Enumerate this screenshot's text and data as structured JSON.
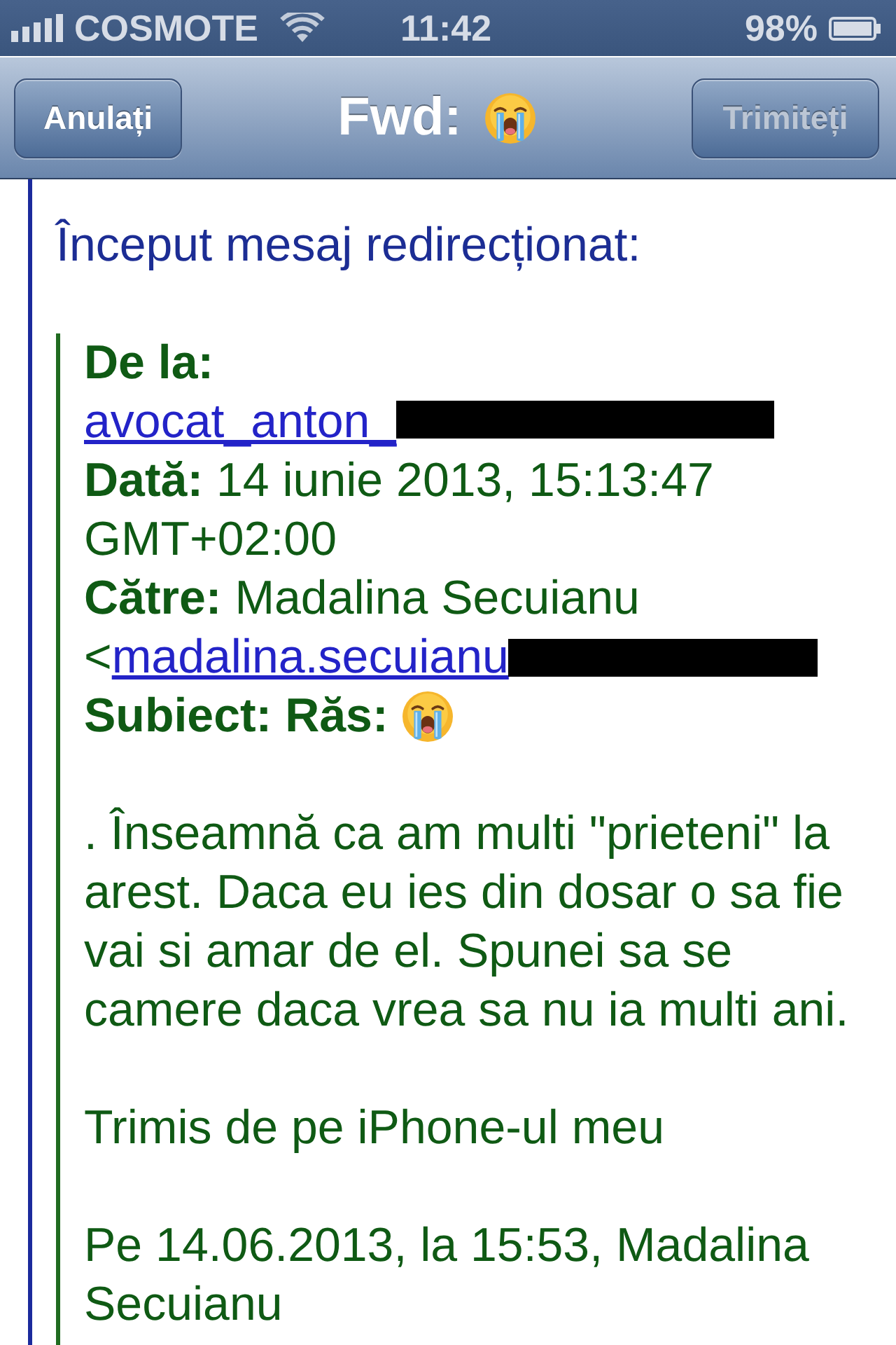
{
  "status_bar": {
    "carrier": "COSMOTE",
    "time": "11:42",
    "battery": "98%"
  },
  "nav_bar": {
    "cancel_button": {
      "label": "Anulați"
    },
    "title": "Fwd:",
    "send_button": {
      "label": "Trimiteți",
      "disabled": true
    }
  },
  "message": {
    "intro": "Început mesaj redirecționat:",
    "headers": [
      {
        "kind": "link",
        "label": "De la:",
        "link": "avocat_anton_",
        "redacted": true
      },
      {
        "kind": "text",
        "label": "Dată:",
        "value": "14 iunie 2013, 15:13:47 GMT+02:00"
      },
      {
        "kind": "text_link",
        "label": "Către:",
        "value": "Madalina Secuianu",
        "prefix": "<",
        "link": "madalina.secuianu",
        "redacted": true
      },
      {
        "kind": "subject",
        "label": "Subiect:",
        "value": "Răs:"
      }
    ],
    "body": [
      ". Înseamnă ca am multi \"prieteni\" la arest. Daca eu ies din dosar o sa fie vai si amar de el. Spunei sa se camere daca vrea sa nu ia multi ani.",
      "Trimis de pe iPhone-ul meu",
      "Pe 14.06.2013, la 15:53, Madalina Secuianu"
    ]
  }
}
